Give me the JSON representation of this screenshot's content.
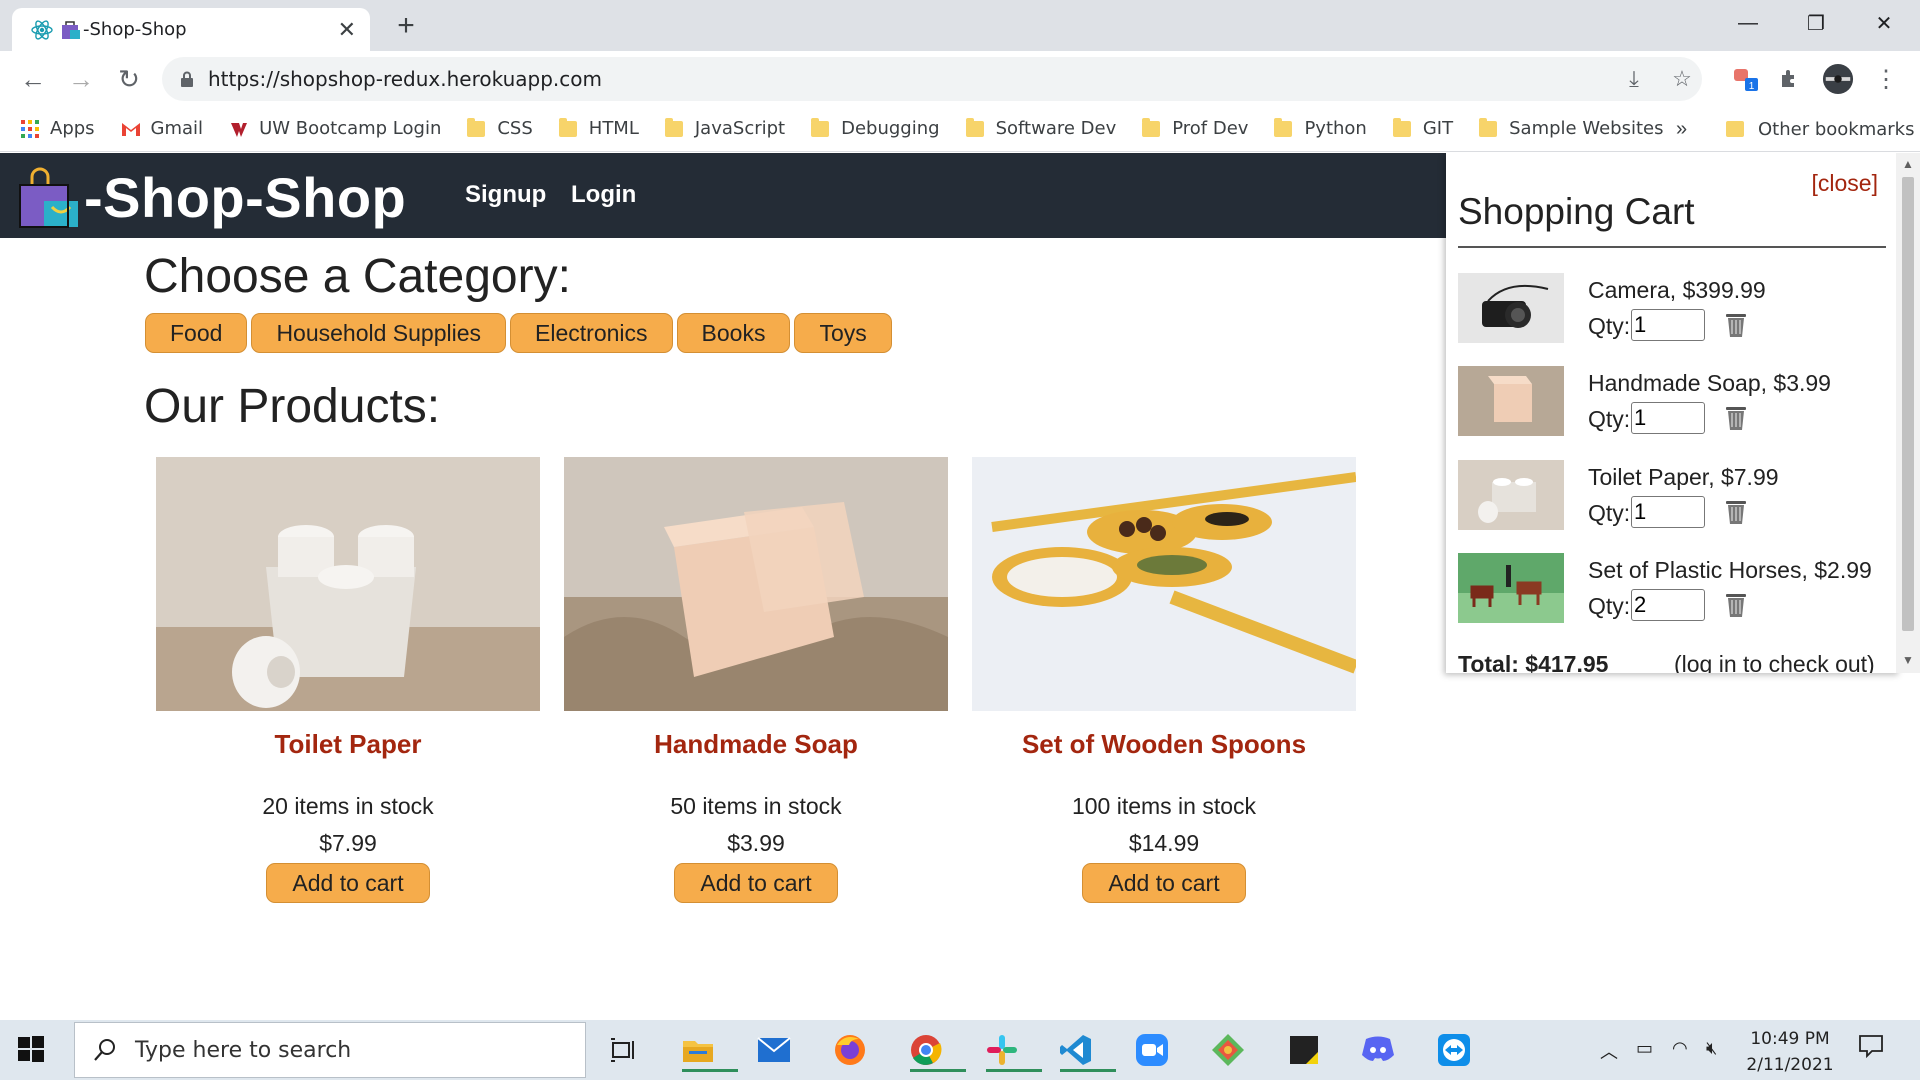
{
  "browser": {
    "tab_title": "-Shop-Shop",
    "url": "https://shopshop-redux.herokuapp.com",
    "bookmarks": [
      "Apps",
      "Gmail",
      "UW Bootcamp Login",
      "CSS",
      "HTML",
      "JavaScript",
      "Debugging",
      "Software Dev",
      "Prof Dev",
      "Python",
      "GIT",
      "Sample Websites"
    ],
    "more_bookmarks": "»",
    "other_bookmarks": "Other bookmarks",
    "extension_badge": "1"
  },
  "site": {
    "brand": "-Shop-Shop",
    "nav": {
      "signup": "Signup",
      "login": "Login"
    },
    "category_heading": "Choose a Category:",
    "categories": [
      "Food",
      "Household Supplies",
      "Electronics",
      "Books",
      "Toys"
    ],
    "products_heading": "Our Products:",
    "products": [
      {
        "name": "Toilet Paper",
        "stock": "20 items in stock",
        "price": "$7.99",
        "button": "Add to cart"
      },
      {
        "name": "Handmade Soap",
        "stock": "50 items in stock",
        "price": "$3.99",
        "button": "Add to cart"
      },
      {
        "name": "Set of Wooden Spoons",
        "stock": "100 items in stock",
        "price": "$14.99",
        "button": "Add to cart"
      }
    ]
  },
  "cart": {
    "close": "[close]",
    "title": "Shopping Cart",
    "qty_label": "Qty:",
    "items": [
      {
        "name": "Camera, $399.99",
        "qty": "1"
      },
      {
        "name": "Handmade Soap, $3.99",
        "qty": "1"
      },
      {
        "name": "Toilet Paper, $7.99",
        "qty": "1"
      },
      {
        "name": "Set of Plastic Horses, $2.99",
        "qty": "2"
      }
    ],
    "total": "Total: $417.95",
    "checkout_note": "(log in to check out)"
  },
  "taskbar": {
    "search_placeholder": "Type here to search",
    "time": "10:49 PM",
    "date": "2/11/2021"
  },
  "colors": {
    "header_bg": "#242c36",
    "accent_button": "#f6ac4b",
    "product_name": "#a3260f",
    "taskbar_bg": "#dfe7ee"
  }
}
